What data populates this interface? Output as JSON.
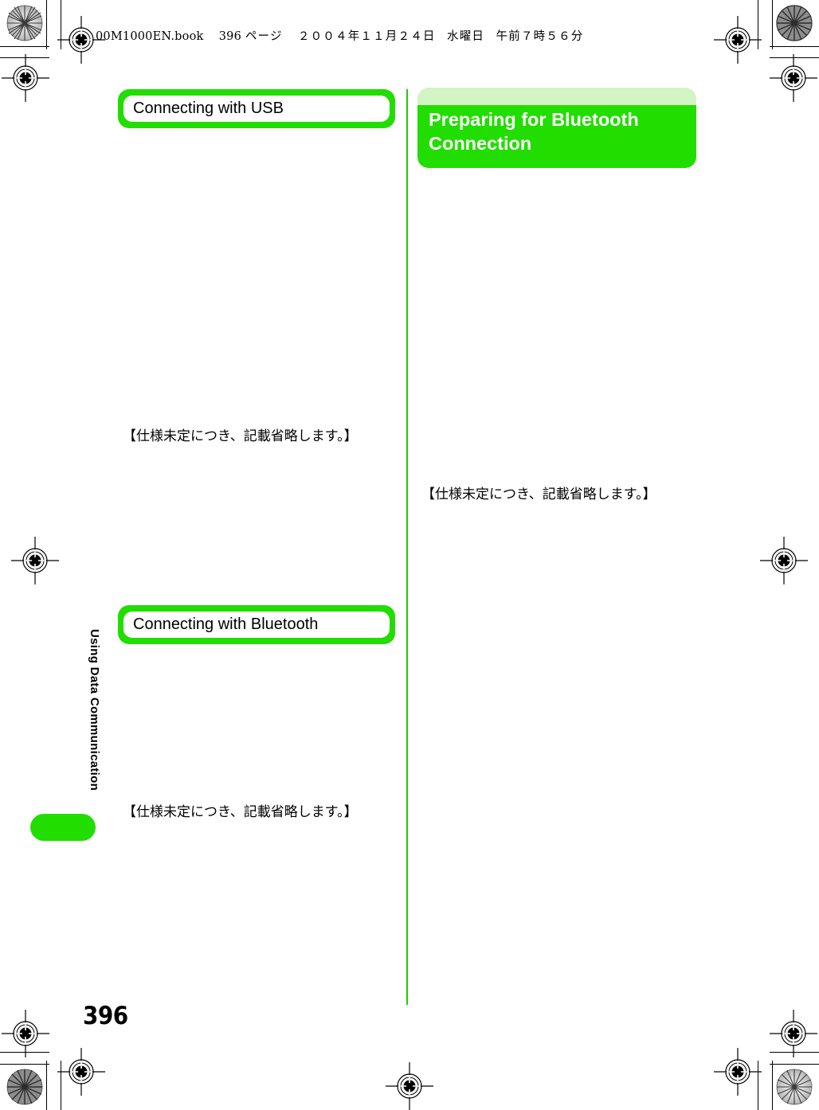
{
  "page": {
    "file_stamp_name": "00M1000EN.book",
    "file_stamp_page": "396",
    "file_stamp_page_unit": "ページ",
    "file_stamp_date": "２００４年１１月２４日",
    "file_stamp_day": "水曜日",
    "file_stamp_time": "午前７時５６分",
    "page_number": "396",
    "side_tab_label": "Using Data Communication"
  },
  "colors": {
    "accent_green": "#22dd00",
    "light_green": "#d3f5c4",
    "divider_green": "#22cc00",
    "text_black": "#000000",
    "heading_white": "#ffffff"
  },
  "left_column": {
    "section_1": {
      "heading": "Connecting with USB",
      "note": "【仕様未定につき、記載省略します。】"
    },
    "section_2": {
      "heading": "Connecting with Bluetooth",
      "note": "【仕様未定につき、記載省略します。】"
    }
  },
  "right_column": {
    "section_1": {
      "heading_line_1": "Preparing for Bluetooth",
      "heading_line_2": "Connection",
      "note": "【仕様未定につき、記載省略します。】"
    }
  }
}
